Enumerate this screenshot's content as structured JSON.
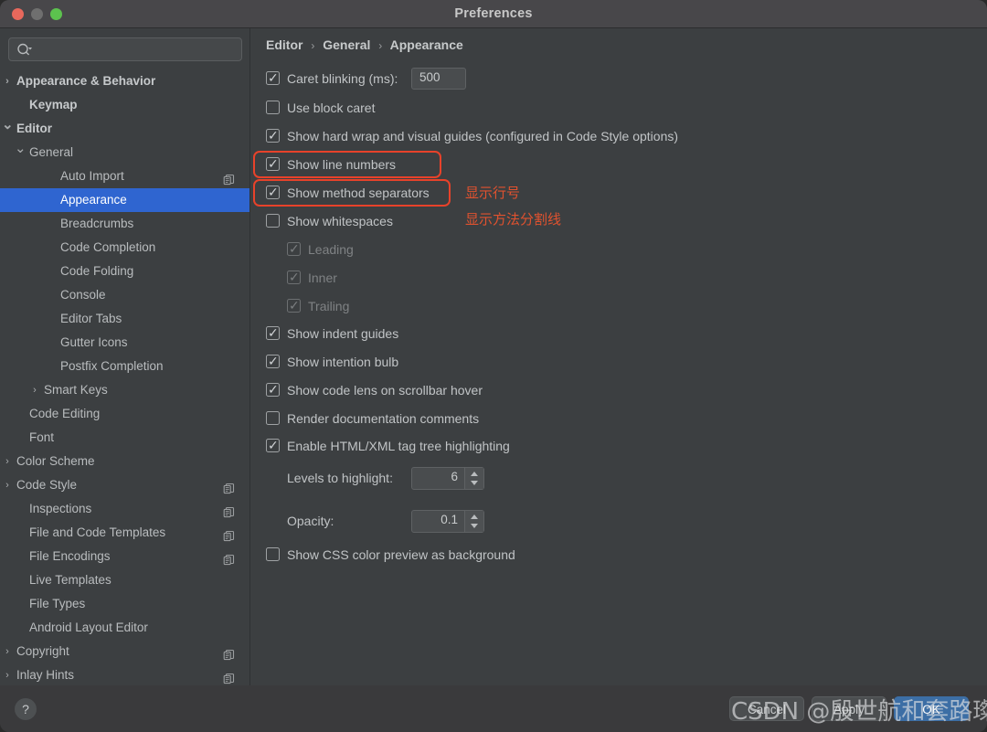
{
  "window": {
    "title": "Preferences",
    "traffic_lights": [
      "close-red",
      "minimize-gray",
      "maximize-green"
    ]
  },
  "sidebar": {
    "search": {
      "value": "",
      "placeholder": "",
      "icon": "search-icon"
    },
    "items": [
      {
        "label": "Appearance & Behavior",
        "indent": 1,
        "arrow": "›",
        "bold": true,
        "selected": false,
        "copy": false
      },
      {
        "label": "Keymap",
        "indent": 2,
        "arrow": "",
        "bold": true,
        "selected": false,
        "copy": false
      },
      {
        "label": "Editor",
        "indent": 1,
        "arrow": "⌄",
        "bold": true,
        "selected": false,
        "copy": false
      },
      {
        "label": "General",
        "indent": 2,
        "arrow": "⌄",
        "bold": false,
        "selected": false,
        "copy": false
      },
      {
        "label": "Auto Import",
        "indent": 4,
        "arrow": "",
        "bold": false,
        "selected": false,
        "copy": true
      },
      {
        "label": "Appearance",
        "indent": 4,
        "arrow": "",
        "bold": false,
        "selected": true,
        "copy": false
      },
      {
        "label": "Breadcrumbs",
        "indent": 4,
        "arrow": "",
        "bold": false,
        "selected": false,
        "copy": false
      },
      {
        "label": "Code Completion",
        "indent": 4,
        "arrow": "",
        "bold": false,
        "selected": false,
        "copy": false
      },
      {
        "label": "Code Folding",
        "indent": 4,
        "arrow": "",
        "bold": false,
        "selected": false,
        "copy": false
      },
      {
        "label": "Console",
        "indent": 4,
        "arrow": "",
        "bold": false,
        "selected": false,
        "copy": false
      },
      {
        "label": "Editor Tabs",
        "indent": 4,
        "arrow": "",
        "bold": false,
        "selected": false,
        "copy": false
      },
      {
        "label": "Gutter Icons",
        "indent": 4,
        "arrow": "",
        "bold": false,
        "selected": false,
        "copy": false
      },
      {
        "label": "Postfix Completion",
        "indent": 4,
        "arrow": "",
        "bold": false,
        "selected": false,
        "copy": false
      },
      {
        "label": "Smart Keys",
        "indent": 3,
        "arrow": "›",
        "bold": false,
        "selected": false,
        "copy": false
      },
      {
        "label": "Code Editing",
        "indent": 2,
        "arrow": "",
        "bold": false,
        "selected": false,
        "copy": false
      },
      {
        "label": "Font",
        "indent": 2,
        "arrow": "",
        "bold": false,
        "selected": false,
        "copy": false
      },
      {
        "label": "Color Scheme",
        "indent": 1,
        "arrow": "›",
        "bold": false,
        "selected": false,
        "copy": false
      },
      {
        "label": "Code Style",
        "indent": 1,
        "arrow": "›",
        "bold": false,
        "selected": false,
        "copy": true
      },
      {
        "label": "Inspections",
        "indent": 2,
        "arrow": "",
        "bold": false,
        "selected": false,
        "copy": true
      },
      {
        "label": "File and Code Templates",
        "indent": 2,
        "arrow": "",
        "bold": false,
        "selected": false,
        "copy": true
      },
      {
        "label": "File Encodings",
        "indent": 2,
        "arrow": "",
        "bold": false,
        "selected": false,
        "copy": true
      },
      {
        "label": "Live Templates",
        "indent": 2,
        "arrow": "",
        "bold": false,
        "selected": false,
        "copy": false
      },
      {
        "label": "File Types",
        "indent": 2,
        "arrow": "",
        "bold": false,
        "selected": false,
        "copy": false
      },
      {
        "label": "Android Layout Editor",
        "indent": 2,
        "arrow": "",
        "bold": false,
        "selected": false,
        "copy": false
      },
      {
        "label": "Copyright",
        "indent": 1,
        "arrow": "›",
        "bold": false,
        "selected": false,
        "copy": true
      },
      {
        "label": "Inlay Hints",
        "indent": 1,
        "arrow": "›",
        "bold": false,
        "selected": false,
        "copy": true
      }
    ]
  },
  "breadcrumb": {
    "root": "Editor",
    "mid": "General",
    "leaf": "Appearance",
    "separator": "›"
  },
  "options": [
    {
      "label": "Caret blinking (ms):",
      "checked": true,
      "enabled": true
    },
    {
      "label": "Use block caret",
      "checked": false,
      "enabled": true
    },
    {
      "label": "Show hard wrap and visual guides (configured in Code Style options)",
      "checked": true,
      "enabled": true
    },
    {
      "label": "Show line numbers",
      "checked": true,
      "enabled": true
    },
    {
      "label": "Show method separators",
      "checked": true,
      "enabled": true
    },
    {
      "label": "Show whitespaces",
      "checked": false,
      "enabled": true
    },
    {
      "label": "Leading",
      "checked": true,
      "enabled": false
    },
    {
      "label": "Inner",
      "checked": true,
      "enabled": false
    },
    {
      "label": "Trailing",
      "checked": true,
      "enabled": false
    },
    {
      "label": "Show indent guides",
      "checked": true,
      "enabled": true
    },
    {
      "label": "Show intention bulb",
      "checked": true,
      "enabled": true
    },
    {
      "label": "Show code lens on scrollbar hover",
      "checked": true,
      "enabled": true
    },
    {
      "label": "Render documentation comments",
      "checked": false,
      "enabled": true
    },
    {
      "label": "Enable HTML/XML tag tree highlighting",
      "checked": true,
      "enabled": true
    },
    {
      "label": "Show CSS color preview as background",
      "checked": false,
      "enabled": true
    }
  ],
  "fields": {
    "caret_blinking_value": "500",
    "levels_to_highlight_label": "Levels to highlight:",
    "levels_to_highlight_value": "6",
    "opacity_label": "Opacity:",
    "opacity_value": "0.1"
  },
  "annotations": [
    {
      "text": "显示行号",
      "color": "#e0522f"
    },
    {
      "text": "显示方法分割线",
      "color": "#e0522f"
    }
  ],
  "footer": {
    "help_label": "?",
    "cancel_label": "Cancel",
    "apply_label": "Apply",
    "ok_label": "OK",
    "watermark": "CSDN @殷世航和套路璨"
  },
  "colors": {
    "window_bg": "#3c3f41",
    "titlebar_bg": "#48474a",
    "selection_blue": "#2f65d0",
    "primary_button": "#3c6ea5",
    "annotation_red": "#e8422a"
  }
}
